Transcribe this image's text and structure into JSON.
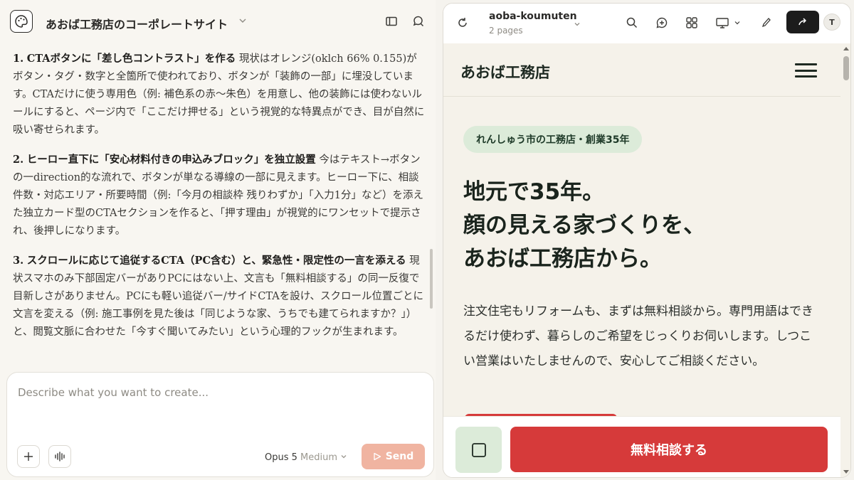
{
  "left_panel": {
    "project_title": "あおば工務店のコーポレートサイト",
    "messages": [
      {
        "num": "1.",
        "heading": "CTAボタンに「差し色コントラスト」を作る",
        "body": "現状はオレンジ(oklch 66% 0.155)がボタン・タグ・数字と全箇所で使われており、ボタンが「装飾の一部」に埋没しています。CTAだけに使う専用色（例: 補色系の赤〜朱色）を用意し、他の装飾には使わないルールにすると、ページ内で「ここだけ押せる」という視覚的な特異点ができ、目が自然に吸い寄せられます。"
      },
      {
        "num": "2.",
        "heading": "ヒーロー直下に「安心材料付きの申込みブロック」を独立設置",
        "body": "今はテキスト→ボタンの一direction的な流れで、ボタンが単なる導線の一部に見えます。ヒーロー下に、相談件数・対応エリア・所要時間（例:「今月の相談枠 残りわずか」「入力1分」など）を添えた独立カード型のCTAセクションを作ると、「押す理由」が視覚的にワンセットで提示され、後押しになります。"
      },
      {
        "num": "3.",
        "heading": "スクロールに応じて追従するCTA（PC含む）と、緊急性・限定性の一言を添える",
        "body": "現状スマホのみ下部固定バーがありPCにはない上、文言も「無料相談する」の同一反復で目新しさがありません。PCにも軽い追従バー/サイドCTAを設け、スクロール位置ごとに文言を変える（例: 施工事例を見た後は「同じような家、うちでも建てられますか？」）と、閲覧文脈に合わせた「今すぐ聞いてみたい」という心理的フックが生まれます。"
      }
    ],
    "composer": {
      "placeholder": "Describe what you want to create...",
      "model": "Opus 5",
      "effort": "Medium",
      "send_label": "Send"
    }
  },
  "right_panel": {
    "site_name": "aoba-koumuten",
    "pages_count": "2 pages",
    "avatar_initial": "T",
    "preview": {
      "logo": "あおば工務店",
      "badge": "れんしゅう市の工務店・創業35年",
      "hero_lines": [
        "地元で35年。",
        "顔の見える家づくりを、",
        "あおば工務店から。"
      ],
      "lead": "注文住宅もリフォームも、まずは無料相談から。専門用語はできるだけ使わず、暮らしのご希望をじっくりお伺いします。しつこい営業はいたしませんので、安心してご相談ください。",
      "cta_label": "無料相談する"
    }
  },
  "colors": {
    "accent_red": "#d63a3a",
    "badge_green": "#dcebd9",
    "send_disabled": "#f0b4a1",
    "preview_bg": "#f5f2ea"
  }
}
